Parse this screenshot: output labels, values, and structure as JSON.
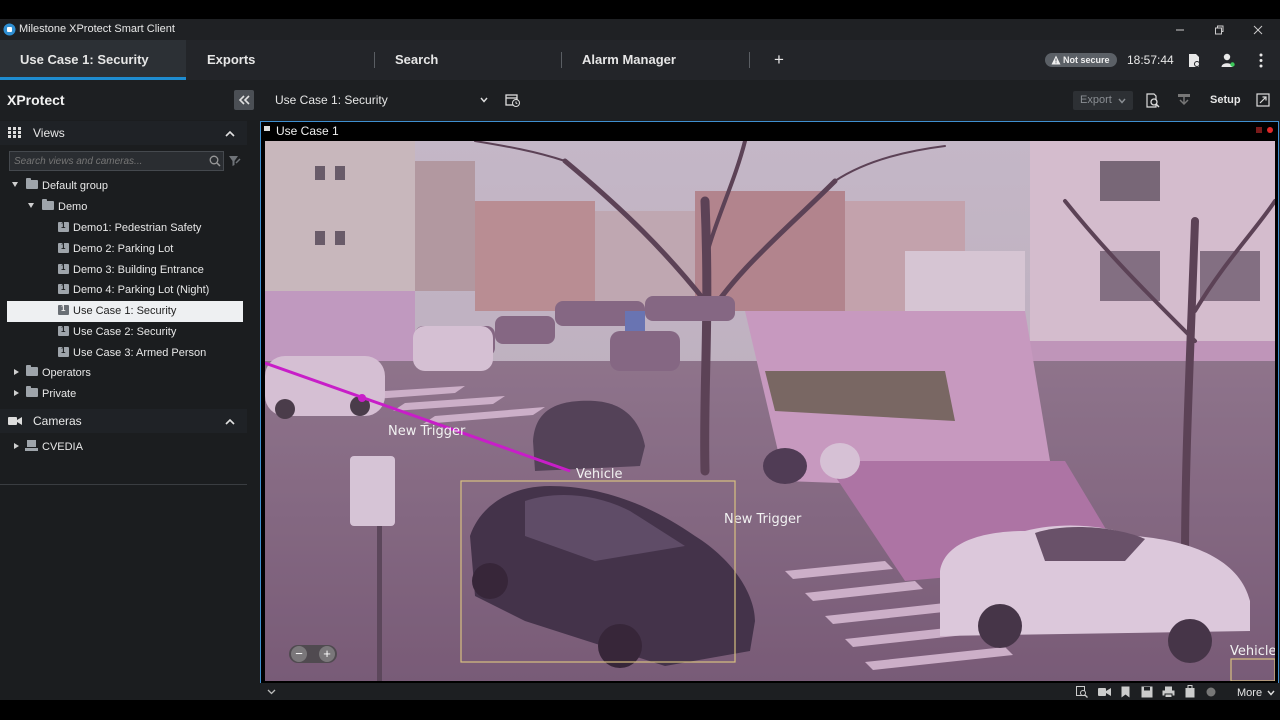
{
  "window": {
    "title": "Milestone XProtect Smart Client",
    "icons": [
      "minimize-icon",
      "restore-icon",
      "close-icon"
    ]
  },
  "tabs": [
    {
      "label": "Use Case 1: Security",
      "active": true
    },
    {
      "label": "Exports"
    },
    {
      "label": "Search"
    },
    {
      "label": "Alarm Manager"
    }
  ],
  "header": {
    "add_tab_label": "+",
    "security_badge": "Not secure",
    "time": "18:57:44"
  },
  "toolbar": {
    "brand": "XProtect",
    "view_selected": "Use Case 1: Security",
    "export_label": "Export",
    "setup_label": "Setup"
  },
  "sidebar": {
    "views_title": "Views",
    "search_placeholder": "Search views and cameras...",
    "tree": {
      "default_group": "Default group",
      "demo": "Demo",
      "items": [
        "Demo1: Pedestrian Safety",
        "Demo 2: Parking Lot",
        "Demo 3: Building Entrance",
        "Demo 4: Parking Lot (Night)",
        "Use Case 1: Security",
        "Use Case 2: Security",
        "Use Case 3: Armed Person"
      ],
      "operators": "Operators",
      "private": "Private"
    },
    "cameras_title": "Cameras",
    "camera_root": "CVEDIA"
  },
  "view": {
    "title": "Use Case 1",
    "overlays": {
      "trigger_1": "New Trigger",
      "trigger_2": "New Trigger",
      "vehicle_1": "Vehicle",
      "vehicle_2": "Vehicle"
    },
    "zoom_out": "−",
    "zoom_in": "+"
  },
  "bottom": {
    "more_label": "More"
  },
  "colors": {
    "accent": "#1e8cd0",
    "trigger_line": "#c81ec8",
    "vehicle_box": "#d8c080",
    "tint": "#a060a0"
  }
}
